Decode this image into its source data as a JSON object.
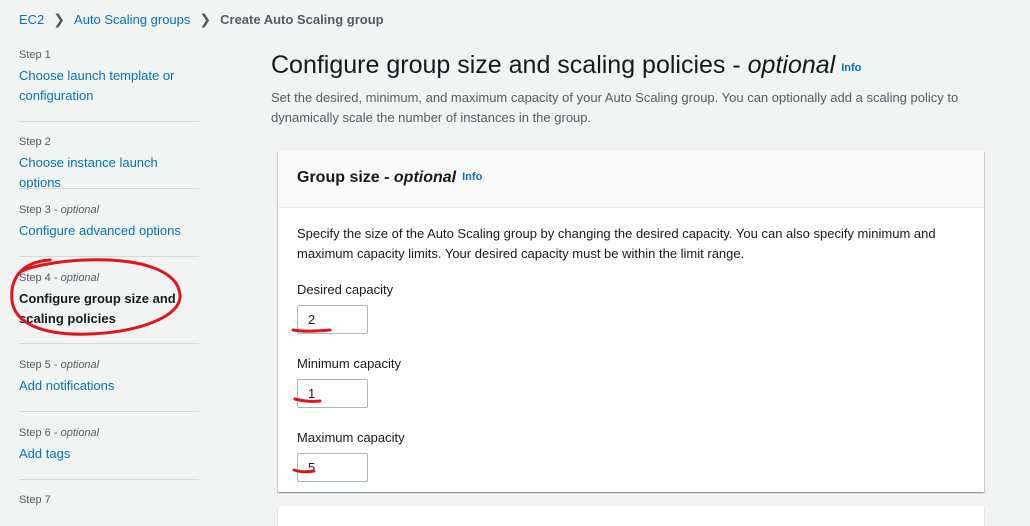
{
  "breadcrumb": {
    "items": [
      {
        "label": "EC2"
      },
      {
        "label": "Auto Scaling groups"
      }
    ],
    "current": "Create Auto Scaling group"
  },
  "sidebar": {
    "steps": [
      {
        "label": "Step 1",
        "optional": "",
        "title": "Choose launch template or configuration"
      },
      {
        "label": "Step 2",
        "optional": "",
        "title": "Choose instance launch options"
      },
      {
        "label": "Step 3 - ",
        "optional": "optional",
        "title": "Configure advanced options"
      },
      {
        "label": "Step 4 - ",
        "optional": "optional",
        "title": "Configure group size and scaling policies"
      },
      {
        "label": "Step 5 - ",
        "optional": "optional",
        "title": "Add notifications"
      },
      {
        "label": "Step 6 - ",
        "optional": "optional",
        "title": "Add tags"
      },
      {
        "label": "Step 7",
        "optional": "",
        "title": ""
      }
    ],
    "active_step": 4
  },
  "main": {
    "title": "Configure group size and scaling policies - ",
    "title_italic": "optional",
    "info": "Info",
    "description": "Set the desired, minimum, and maximum capacity of your Auto Scaling group. You can optionally add a scaling policy to dynamically scale the number of instances in the group."
  },
  "group_size": {
    "title": "Group size - ",
    "title_italic": "optional",
    "info": "Info",
    "description": "Specify the size of the Auto Scaling group by changing the desired capacity. You can also specify minimum and maximum capacity limits. Your desired capacity must be within the limit range.",
    "desired_label": "Desired capacity",
    "desired_value": "2",
    "minimum_label": "Minimum capacity",
    "minimum_value": "1",
    "maximum_label": "Maximum capacity",
    "maximum_value": "5"
  },
  "colors": {
    "link": "#0073bb",
    "annotation": "#e0161b"
  }
}
